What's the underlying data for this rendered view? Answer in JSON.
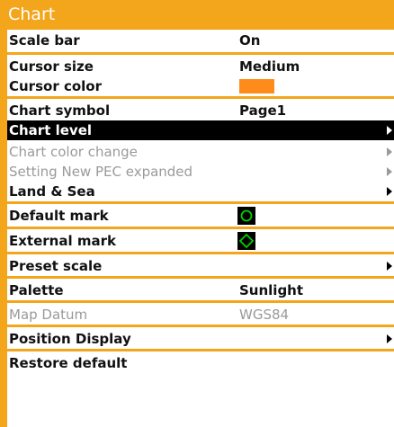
{
  "title": "Chart",
  "colors": {
    "accent": "#f3a51b",
    "cursor_color": "#ff8c1a",
    "mark_green": "#00d000"
  },
  "items": {
    "scale_bar": {
      "label": "Scale bar",
      "value": "On"
    },
    "cursor_size": {
      "label": "Cursor size",
      "value": "Medium"
    },
    "cursor_color": {
      "label": "Cursor color"
    },
    "chart_symbol": {
      "label": "Chart symbol",
      "value": "Page1"
    },
    "chart_level": {
      "label": "Chart level"
    },
    "chart_color_change": {
      "label": "Chart color change"
    },
    "setting_new_pec": {
      "label": "Setting New PEC expanded"
    },
    "land_sea": {
      "label": "Land & Sea"
    },
    "default_mark": {
      "label": "Default mark",
      "icon": "circle-mark-icon"
    },
    "external_mark": {
      "label": "External mark",
      "icon": "diamond-mark-icon"
    },
    "preset_scale": {
      "label": "Preset scale"
    },
    "palette": {
      "label": "Palette",
      "value": "Sunlight"
    },
    "map_datum": {
      "label": "Map Datum",
      "value": "WGS84"
    },
    "position_display": {
      "label": "Position Display"
    },
    "restore_default": {
      "label": "Restore default"
    }
  }
}
